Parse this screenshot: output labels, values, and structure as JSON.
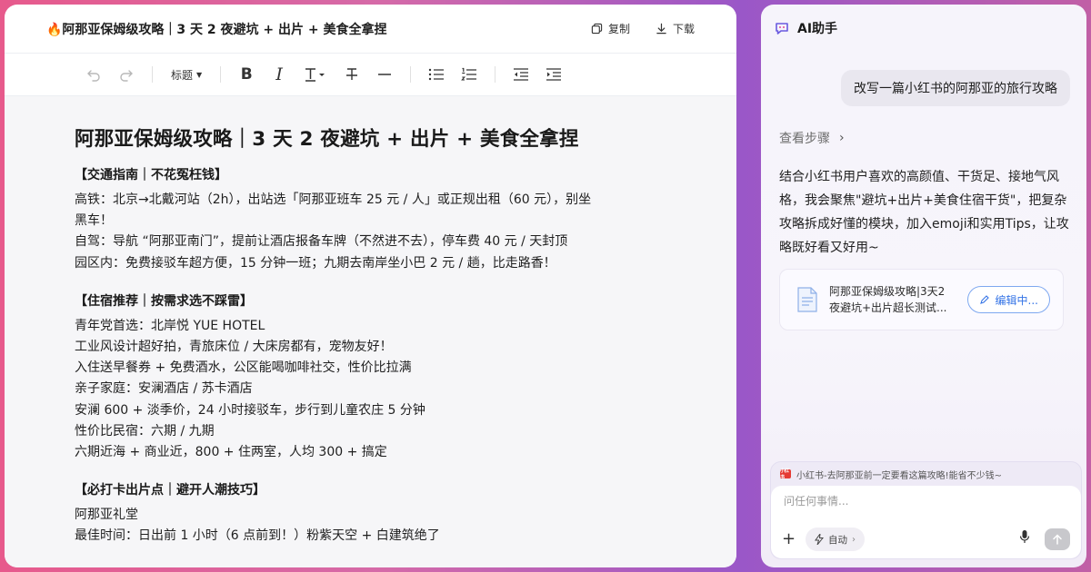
{
  "editor": {
    "title": "🔥阿那亚保姆级攻略｜3 天 2 夜避坑 + 出片 + 美食全拿捏",
    "copy_label": "复制",
    "download_label": "下载",
    "toolbar": {
      "heading_label": "标题"
    },
    "doc_title": "阿那亚保姆级攻略｜3 天 2 夜避坑 + 出片 + 美食全拿捏",
    "sections": [
      {
        "heading": "【交通指南｜不花冤枉钱】",
        "lines": [
          "高铁：北京→北戴河站（2h），出站选「阿那亚班车 25 元 / 人」或正规出租（60 元），别坐",
          "黑车！",
          "自驾：导航 “阿那亚南门”，提前让酒店报备车牌（不然进不去），停车费 40 元 / 天封顶",
          "园区内：免费接驳车超方便，15 分钟一班；九期去南岸坐小巴 2 元 / 趟，比走路香！"
        ]
      },
      {
        "heading": "【住宿推荐｜按需求选不踩雷】",
        "lines": [
          " 青年党首选：北岸悦 YUE HOTEL",
          "工业风设计超好拍，青旅床位 / 大床房都有，宠物友好！",
          "入住送早餐券 + 免费酒水，公区能喝咖啡社交，性价比拉满",
          " 亲子家庭：安澜酒店 / 苏卡酒店",
          "安澜 600 + 淡季价，24 小时接驳车，步行到儿童农庄 5 分钟",
          " 性价比民宿：六期 / 九期",
          "六期近海 + 商业近，800 + 住两室，人均 300 + 搞定"
        ]
      },
      {
        "heading": "【必打卡出片点｜避开人潮技巧】",
        "lines": [
          " 阿那亚礼堂",
          "最佳时间：日出前 1 小时（6 点前到！）粉紫天空 + 白建筑绝了"
        ]
      }
    ]
  },
  "ai": {
    "title": "AI助手",
    "user_message": "改写一篇小红书的阿那亚的旅行攻略",
    "steps_label": "查看步骤",
    "reply": "结合小红书用户喜欢的高颜值、干货足、接地气风格，我会聚焦\"避坑+出片+美食住宿干货\"，把复杂攻略拆成好懂的模块，加入emoji和实用Tips，让攻略既好看又好用~",
    "doc_card": {
      "line1": "阿那亚保姆级攻略|3天2",
      "line2": "夜避坑+出片超长测试...",
      "edit_label": "编辑中..."
    },
    "reference": {
      "icon_text": "小红书",
      "text": "小红书-去阿那亚前一定要看这篇攻略!能省不少钱~"
    },
    "input": {
      "placeholder": "问任何事情..."
    },
    "auto_label": "自动"
  }
}
